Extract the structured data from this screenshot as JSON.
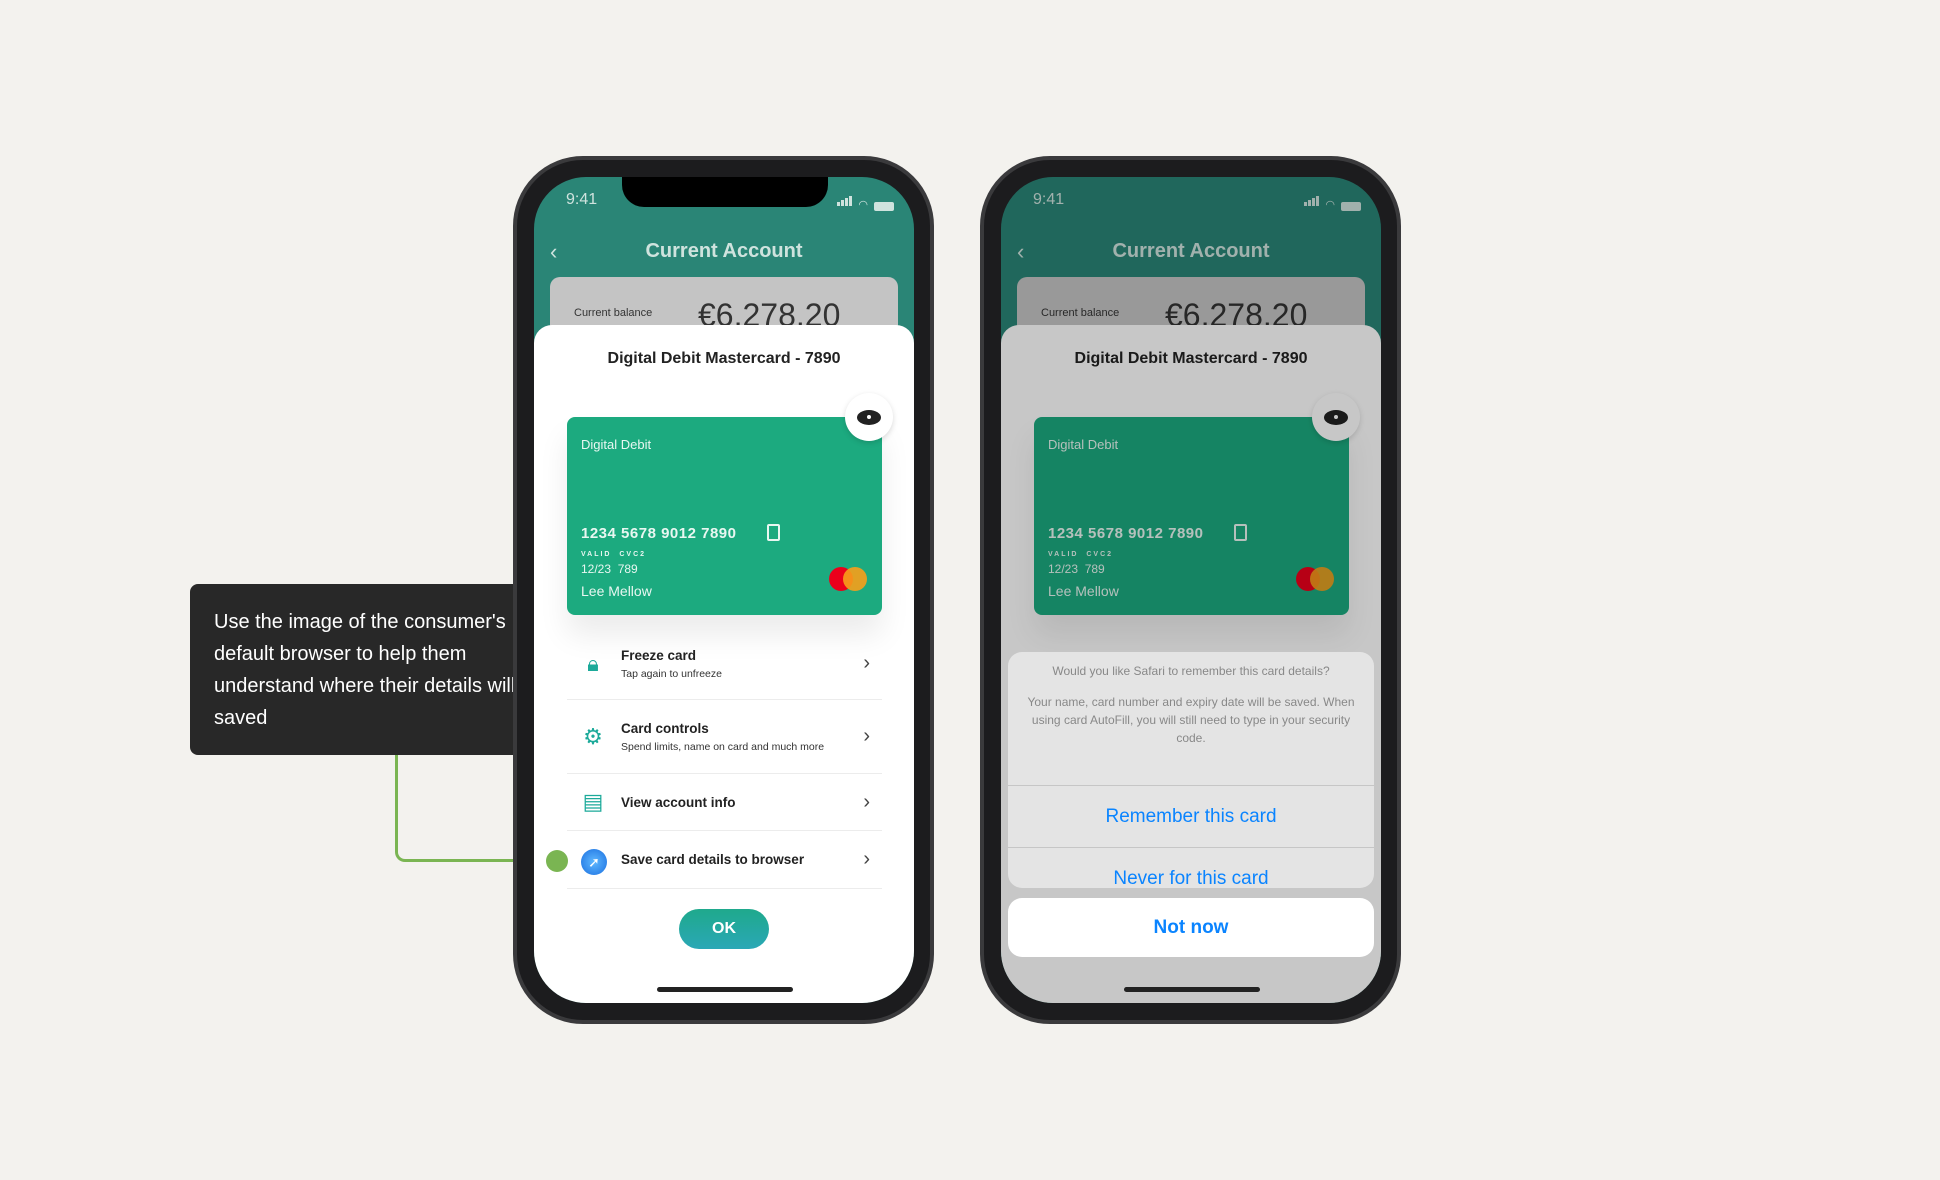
{
  "status": {
    "time": "9:41"
  },
  "header": {
    "back_icon": "chevron-left-icon",
    "title": "Current Account"
  },
  "balance": {
    "label": "Current balance",
    "value": "€6,278.20"
  },
  "sheet": {
    "title": "Digital Debit Mastercard - 7890"
  },
  "card": {
    "type": "Digital Debit",
    "number": "1234 5678 9012 7890",
    "valid_label": "VALID",
    "cvc_label": "CVC2",
    "expiry": "12/23",
    "cvc": "789",
    "holder": "Lee Mellow",
    "color": "#1caa7f"
  },
  "menu": [
    {
      "title": "Freeze card",
      "subtitle": "Tap again to unfreeze",
      "icon": "lock-icon"
    },
    {
      "title": "Card controls",
      "subtitle": "Spend limits, name on card and much more",
      "icon": "gear-icon"
    },
    {
      "title": "View account info",
      "subtitle": "",
      "icon": "document-icon"
    },
    {
      "title": "Save card details to browser",
      "subtitle": "",
      "icon": "safari-icon"
    }
  ],
  "ok_label": "OK",
  "action_sheet": {
    "question": "Would you like Safari to remember this card details?",
    "message": "Your name, card number and expiry date will be saved. When using card AutoFill, you will still need to type in your security code.",
    "remember": "Remember this card",
    "never": "Never for this card",
    "cancel": "Not now",
    "accent": "#0a84ff"
  },
  "annotation": {
    "text": "Use the image of the consumer's default browser to help them understand where their details will be saved",
    "color": "#7ab552"
  }
}
